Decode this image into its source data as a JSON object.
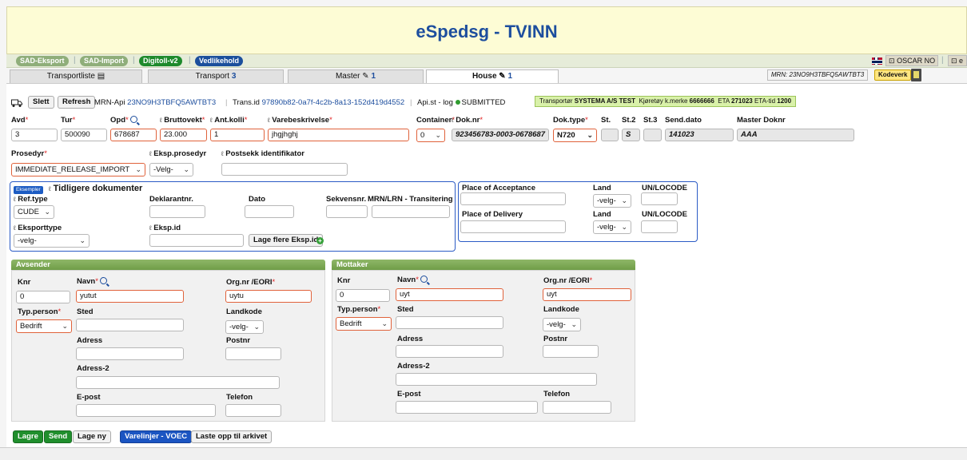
{
  "header": {
    "title_prefix": "eSped",
    "title_suffix": "sg - TVINN"
  },
  "nav": {
    "items": [
      "SAD-Eksport",
      "SAD-Import",
      "Digitoll-v2",
      "Vedlikehold"
    ],
    "user": "OSCAR NO"
  },
  "tabs": [
    {
      "label": "Transportliste"
    },
    {
      "label": "Transport",
      "count": "3"
    },
    {
      "label": "Master",
      "count": "1"
    },
    {
      "label": "House",
      "count": "1"
    }
  ],
  "mrn_badge": "MRN: 23NO9H3TBFQ5AWTBT3",
  "kodeverk": "Kodeverk",
  "toolbar": {
    "slett": "Slett",
    "refresh": "Refresh",
    "mrn_api_label": "MRN-Api",
    "mrn_api_value": "23NO9H3TBFQ5AWTBT3",
    "trans_id_label": "Trans.id",
    "trans_id_value": "97890b82-0a7f-4c2b-8a13-152d419d4552",
    "api_st": "Api.st - log",
    "status": "SUBMITTED",
    "transport_info_prefix": "Transportør",
    "transport_info_company": "SYSTEMA A/S TEST",
    "kjoretoy_label": "Kjøretøy k.merke",
    "kjoretoy_value": "6666666",
    "eta_label": "ETA",
    "eta_value": "271023",
    "eta_tid_label": "ETA-tid",
    "eta_tid_value": "1200"
  },
  "row1": {
    "avd_label": "Avd",
    "avd": "3",
    "tur_label": "Tur",
    "tur": "500090",
    "opd_label": "Opd",
    "opd": "678687",
    "brutto_label": "Bruttovekt",
    "brutto": "23.000",
    "kolli_label": "Ant.kolli",
    "kolli": "1",
    "vare_label": "Varebeskrivelse",
    "vare": "jhgjhghj",
    "container_label": "Container",
    "container": "0",
    "doknr_label": "Dok.nr",
    "doknr": "923456783-0003-0678687",
    "doktype_label": "Dok.type",
    "doktype": "N720",
    "st_label": "St.",
    "st": "",
    "st2_label": "St.2",
    "st2": "S",
    "st3_label": "St.3",
    "st3": "",
    "senddato_label": "Send.dato",
    "senddato": "141023",
    "master_label": "Master Doknr",
    "master": "AAA"
  },
  "row2": {
    "prosedyr_label": "Prosedyr",
    "prosedyr": "IMMEDIATE_RELEASE_IMPORT",
    "eksp_prosedyr_label": "Eksp.prosedyr",
    "eksp_prosedyr": "-Velg-",
    "postsekk_label": "Postsekk identifikator",
    "postsekk": ""
  },
  "tidligere": {
    "badge": "Eksempler",
    "title": "Tidligere dokumenter",
    "reftype_label": "Ref.type",
    "reftype": "CUDE",
    "deklarant_label": "Deklarantnr.",
    "dato_label": "Dato",
    "sekvens_label": "Sekvensnr.",
    "mrn_label": "MRN/LRN - Transitering",
    "eksporttype_label": "Eksporttype",
    "eksporttype": "-velg-",
    "eksp_id_label": "Eksp.id",
    "lage_flere": "Lage flere Eksp.id"
  },
  "place": {
    "acceptance_label": "Place of Acceptance",
    "delivery_label": "Place of Delivery",
    "land_label": "Land",
    "unlocode_label": "UN/LOCODE",
    "land_value": "-velg-"
  },
  "avsender": {
    "title": "Avsender",
    "knr_label": "Knr",
    "knr": "0",
    "navn_label": "Navn",
    "navn": "yutut",
    "orgnr_label": "Org.nr /EORI",
    "orgnr": "uytu",
    "typperson_label": "Typ.person",
    "typperson": "Bedrift",
    "sted_label": "Sted",
    "landkode_label": "Landkode",
    "landkode": "-velg-",
    "adress_label": "Adress",
    "postnr_label": "Postnr",
    "adress2_label": "Adress-2",
    "epost_label": "E-post",
    "telefon_label": "Telefon"
  },
  "mottaker": {
    "title": "Mottaker",
    "knr_label": "Knr",
    "knr": "0",
    "navn_label": "Navn",
    "navn": "uyt",
    "orgnr_label": "Org.nr /EORI",
    "orgnr": "uyt",
    "typperson_label": "Typ.person",
    "typperson": "Bedrift",
    "sted_label": "Sted",
    "landkode_label": "Landkode",
    "landkode": "-velg-",
    "adress_label": "Adress",
    "postnr_label": "Postnr",
    "adress2_label": "Adress-2",
    "epost_label": "E-post",
    "telefon_label": "Telefon"
  },
  "bottom": {
    "lagre": "Lagre",
    "send": "Send",
    "lage_ny": "Lage ny",
    "varelinjer": "Varelinjer - VOEC",
    "laste_opp": "Laste opp til arkivet"
  }
}
